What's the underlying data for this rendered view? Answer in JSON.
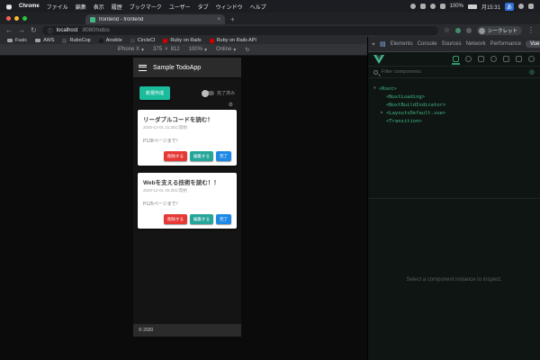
{
  "menubar": {
    "app_name": "Chrome",
    "menus": [
      "ファイル",
      "編集",
      "表示",
      "履歴",
      "ブックマーク",
      "ユーザー",
      "タブ",
      "ウィンドウ",
      "ヘルプ"
    ],
    "battery": "100%",
    "clock": "月15:31",
    "ime_badge": "あ"
  },
  "tab": {
    "title": "frontend - frontend",
    "close": "×",
    "new_tab": "+"
  },
  "urlbar": {
    "back": "←",
    "forward": "→",
    "reload": "↻",
    "info": "ⓘ",
    "host": "localhost",
    "path": ":8080/todos",
    "star": "☆",
    "profile_label": "シークレット",
    "menu_dots": "⋮"
  },
  "bookmarks": [
    {
      "label": "Fusic"
    },
    {
      "label": "AWS"
    },
    {
      "label": "RuboCop"
    },
    {
      "label": "Ansible"
    },
    {
      "label": "CircleCI"
    },
    {
      "label": "Ruby on Rails"
    },
    {
      "label": "Ruby on Rails API"
    }
  ],
  "device_toolbar": {
    "device": "iPhone X",
    "caret": "▾",
    "width": "375",
    "times": "×",
    "height": "812",
    "zoom": "100%",
    "throttle": "Online",
    "rotate": "↻"
  },
  "app": {
    "title": "Sample TodoApp",
    "new_button": "新規作成",
    "completed_toggle": "完了済み",
    "gear": "⚙",
    "cards": [
      {
        "title": "リーダブルコードを読む！",
        "started": "2020-12-01 21:30に開始",
        "note": "P128ページまで！"
      },
      {
        "title": "Webを支える技術を読む！！",
        "started": "2020-12-01 20:30に開始",
        "note": "P125ページまで！"
      }
    ],
    "actions": {
      "delete": "削除する",
      "edit": "編集する",
      "complete": "完了"
    },
    "footer": "© 2020"
  },
  "devtools": {
    "tabs": [
      "Elements",
      "Console",
      "Sources",
      "Network",
      "Performance",
      "Vue"
    ],
    "active_tab": "Vue",
    "more_tabs": "»",
    "gear": "⚙",
    "menu_dots": "⋮",
    "vue": {
      "filter_placeholder": "Filter components",
      "inspect_target": "◎",
      "tree": [
        {
          "arrow": "▼",
          "label": "<Root>"
        },
        {
          "arrow": "",
          "label": "<NuxtLoading>"
        },
        {
          "arrow": "",
          "label": "<NuxtBuildIndicator>"
        },
        {
          "arrow": "▶",
          "label": "<LayoutsDefault.vue>"
        },
        {
          "arrow": "",
          "label": "<Transition>"
        }
      ],
      "empty_message": "Select a component instance to inspect."
    }
  },
  "colors": {
    "accent_teal": "#1abc9c",
    "delete_red": "#e53935",
    "edit_teal": "#26a69a",
    "complete_blue": "#1e88e5",
    "vue_green": "#41b883",
    "devtools_active_blue": "#8ab4f8"
  }
}
